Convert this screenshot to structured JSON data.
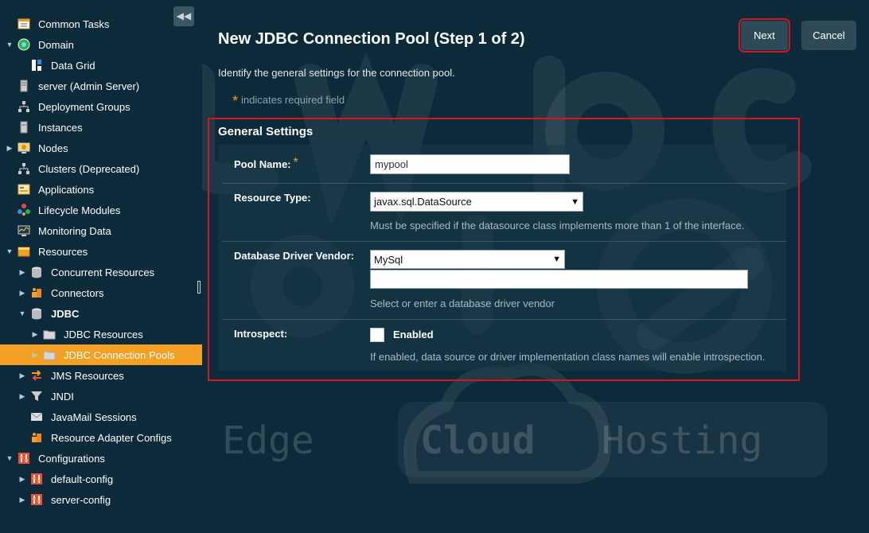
{
  "sidebar": {
    "collapse_glyph": "◀◀",
    "items": [
      {
        "label": "Common Tasks",
        "icon": "tasks-icon",
        "twisty": "",
        "bold": false
      },
      {
        "label": "Domain",
        "icon": "globe-icon",
        "twisty": "▼",
        "bold": false
      },
      {
        "label": "Data Grid",
        "icon": "data-grid-icon",
        "twisty": "",
        "bold": false
      },
      {
        "label": "server (Admin Server)",
        "icon": "server-icon",
        "twisty": "",
        "bold": false
      },
      {
        "label": "Deployment Groups",
        "icon": "deployment-groups-icon",
        "twisty": "",
        "bold": false
      },
      {
        "label": "Instances",
        "icon": "instances-icon",
        "twisty": "",
        "bold": false
      },
      {
        "label": "Nodes",
        "icon": "nodes-icon",
        "twisty": "▶",
        "bold": false
      },
      {
        "label": "Clusters (Deprecated)",
        "icon": "clusters-icon",
        "twisty": "",
        "bold": false
      },
      {
        "label": "Applications",
        "icon": "applications-icon",
        "twisty": "",
        "bold": false
      },
      {
        "label": "Lifecycle Modules",
        "icon": "lifecycle-icon",
        "twisty": "",
        "bold": false
      },
      {
        "label": "Monitoring Data",
        "icon": "monitoring-icon",
        "twisty": "",
        "bold": false
      },
      {
        "label": "Resources",
        "icon": "resources-icon",
        "twisty": "▼",
        "bold": false
      },
      {
        "label": "Concurrent Resources",
        "icon": "database-icon",
        "twisty": "▶",
        "bold": false
      },
      {
        "label": "Connectors",
        "icon": "connectors-icon",
        "twisty": "▶",
        "bold": false
      },
      {
        "label": "JDBC",
        "icon": "database-icon",
        "twisty": "▼",
        "bold": true
      },
      {
        "label": "JDBC Resources",
        "icon": "folder-icon",
        "twisty": "▶",
        "bold": false
      },
      {
        "label": "JDBC Connection Pools",
        "icon": "folder-icon",
        "twisty": "▶",
        "bold": false
      },
      {
        "label": "JMS Resources",
        "icon": "jms-icon",
        "twisty": "▶",
        "bold": false
      },
      {
        "label": "JNDI",
        "icon": "filter-icon",
        "twisty": "▶",
        "bold": false
      },
      {
        "label": "JavaMail Sessions",
        "icon": "mail-icon",
        "twisty": "",
        "bold": false
      },
      {
        "label": "Resource Adapter Configs",
        "icon": "connectors-icon",
        "twisty": "",
        "bold": false
      },
      {
        "label": "Configurations",
        "icon": "config-icon",
        "twisty": "▼",
        "bold": false
      },
      {
        "label": "default-config",
        "icon": "config-icon",
        "twisty": "▶",
        "bold": false
      },
      {
        "label": "server-config",
        "icon": "config-icon",
        "twisty": "▶",
        "bold": false
      }
    ],
    "selected_label": "JDBC Connection Pools"
  },
  "main": {
    "title": "New JDBC Connection Pool (Step 1 of 2)",
    "next_label": "Next",
    "cancel_label": "Cancel",
    "intro": "Identify the general settings for the connection pool.",
    "required_star": "*",
    "required_note": "indicates required field",
    "section_title": "General Settings",
    "fields": {
      "pool_name": {
        "label": "Pool Name:",
        "star": "*",
        "value": "mypool"
      },
      "resource_type": {
        "label": "Resource Type:",
        "value": "javax.sql.DataSource",
        "help": "Must be specified if the datasource class implements more than 1 of the interface."
      },
      "driver_vendor": {
        "label": "Database Driver Vendor:",
        "value": "MySql",
        "text_value": "",
        "help": "Select or enter a database driver vendor"
      },
      "introspect": {
        "label": "Introspect:",
        "checkbox_label": "Enabled",
        "checked": false,
        "help": "If enabled, data source or driver implementation class names will enable introspection."
      }
    }
  },
  "watermark": {
    "text_line1": "jelastic",
    "text_line2": "cloud",
    "tagline_a": "Cutting Edge",
    "tagline_b": "Cloud",
    "tagline_c": "Hosting"
  },
  "colors": {
    "accent": "#f3a024",
    "highlight": "#d9141e",
    "background": "#0c2a3a"
  }
}
